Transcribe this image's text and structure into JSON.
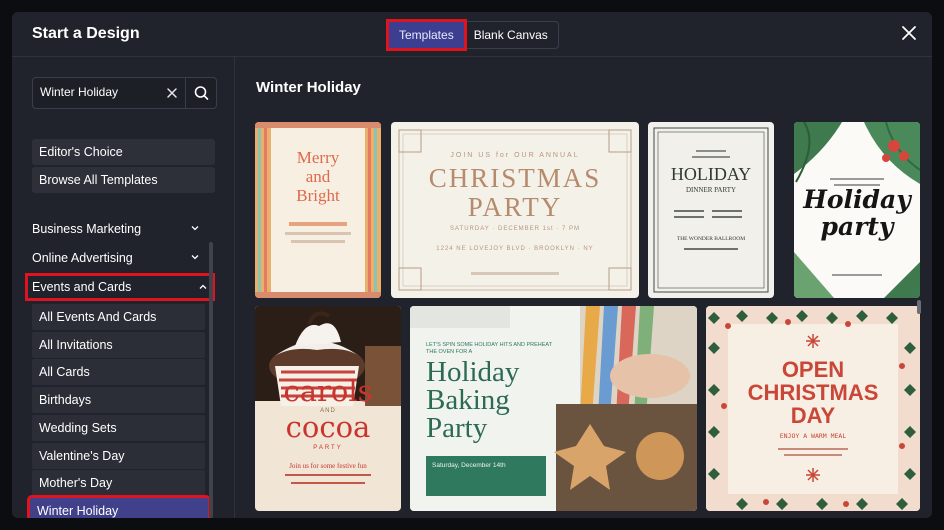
{
  "modal": {
    "title": "Start a Design"
  },
  "tabs": [
    {
      "label": "Templates",
      "active": true
    },
    {
      "label": "Blank Canvas",
      "active": false
    }
  ],
  "icons": {
    "close": "close-icon",
    "clear": "clear-icon",
    "search": "search-icon",
    "chevron_down": "chevron-down-icon",
    "chevron_up": "chevron-up-icon"
  },
  "search": {
    "value": "Winter Holiday"
  },
  "sidebar": {
    "pills": [
      {
        "label": "Editor's Choice"
      },
      {
        "label": "Browse All Templates"
      }
    ],
    "categories": [
      {
        "label": "Business Marketing",
        "expanded": false
      },
      {
        "label": "Online Advertising",
        "expanded": false
      },
      {
        "label": "Events and Cards",
        "expanded": true
      }
    ],
    "subcategories": [
      {
        "label": "All Events And Cards"
      },
      {
        "label": "All Invitations"
      },
      {
        "label": "All Cards"
      },
      {
        "label": "Birthdays"
      },
      {
        "label": "Wedding Sets"
      },
      {
        "label": "Valentine's Day"
      },
      {
        "label": "Mother's Day"
      },
      {
        "label": "Winter Holiday",
        "selected": true
      }
    ]
  },
  "main": {
    "section_title": "Winter Holiday",
    "templates": [
      {
        "lines": [
          "Merry",
          "and",
          "Bright"
        ]
      },
      {
        "top": "JOIN US for OUR ANNUAL",
        "lines": [
          "CHRISTMAS",
          "PARTY"
        ],
        "date": "SATURDAY · DECEMBER 1st · 7 PM",
        "address": "1224 NE LOVEJOY BLVD · BROOKLYN · NY"
      },
      {
        "lines": [
          "HOLIDAY"
        ],
        "sub": "DINNER PARTY",
        "venue": "THE WONDER BALLROOM"
      },
      {
        "lines": [
          "Holiday",
          "party"
        ]
      },
      {
        "lines": [
          "carols",
          "AND",
          "cocoa",
          "PARTY"
        ],
        "tag": "Join us for some festive fun"
      },
      {
        "top": "LET'S SPIN SOME HOLIDAY HITS AND PREHEAT THE OVEN FOR A",
        "lines": [
          "Holiday",
          "Baking",
          "Party"
        ],
        "date": "Saturday, December 14th"
      },
      {
        "lines": [
          "OPEN",
          "CHRISTMAS",
          "DAY"
        ],
        "sub": "ENJOY A WARM MEAL"
      }
    ]
  },
  "colors": {
    "accent": "#3c3f8f",
    "highlight": "#e0141e",
    "modal_bg": "#21232c"
  }
}
